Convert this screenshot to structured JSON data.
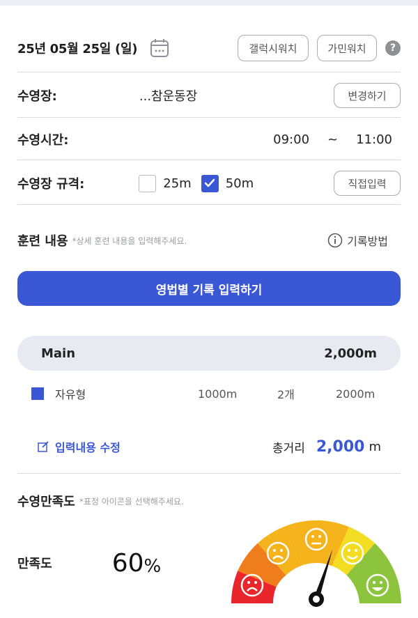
{
  "header": {
    "date": "25년 05월 25일 (일)",
    "gallery_watch_label": "갤럭시워치",
    "garmin_watch_label": "가민워치",
    "help_label": "?"
  },
  "pool": {
    "label": "수영장:",
    "name": "...참운동장",
    "change_label": "변경하기"
  },
  "time": {
    "label": "수영시간:",
    "start": "09:00",
    "separator": "~",
    "end": "11:00"
  },
  "pool_size": {
    "label": "수영장 규격:",
    "option_25": "25m",
    "option_25_checked": false,
    "option_50": "50m",
    "option_50_checked": true,
    "direct_input_label": "직접입력"
  },
  "training": {
    "label": "훈련 내용",
    "hint": "*상세 훈련 내용을 입력해주세요.",
    "record_method_label": "기록방법",
    "record_button_label": "영법별 기록 입력하기"
  },
  "set": {
    "name": "Main",
    "total": "2,000m",
    "items": [
      {
        "stroke": "자유형",
        "distance": "1000m",
        "count": "2개",
        "sum": "2000m",
        "color": "#3a57d6"
      }
    ]
  },
  "summary": {
    "edit_label": "입력내용 수정",
    "total_label": "총거리",
    "total_value": "2,000",
    "total_unit": "m"
  },
  "satisfaction": {
    "title": "수영만족도",
    "hint": "*표정 아이콘을 선택해주세요.",
    "label": "만족도",
    "value": "60",
    "unit": "%",
    "level": 0.6,
    "colors": [
      "#e8262b",
      "#f07d1b",
      "#f5b31c",
      "#f3dd23",
      "#8dc43d"
    ]
  }
}
